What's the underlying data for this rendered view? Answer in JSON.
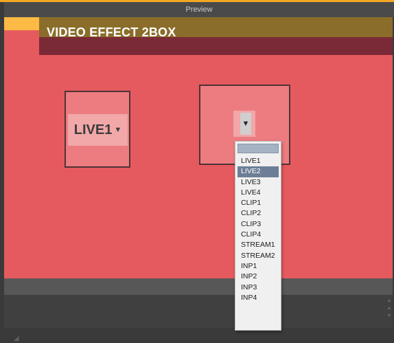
{
  "window": {
    "title": "Preview"
  },
  "preview": {
    "header_title": "VIDEO EFFECT 2BOX",
    "box1": {
      "selected_source": "LIVE1",
      "arrow": "▼"
    },
    "box2": {
      "selected_source": "",
      "arrow": "▼"
    }
  },
  "dropdown": {
    "highlighted": "LIVE2",
    "options": [
      "LIVE1",
      "LIVE2",
      "LIVE3",
      "LIVE4",
      "CLIP1",
      "CLIP2",
      "CLIP3",
      "CLIP4",
      "STREAM1",
      "STREAM2",
      "INP1",
      "INP2",
      "INP3",
      "INP4"
    ]
  },
  "scroll": {
    "up": "▲",
    "down": "▼"
  },
  "colors": {
    "accent_orange": "#f2a823",
    "canvas_red": "#e55a5e",
    "header_gold": "#8a6d2a",
    "header_maroon": "#7a2a36",
    "brand_yellow": "#fdba44",
    "selection_blue": "#6d7f96"
  }
}
